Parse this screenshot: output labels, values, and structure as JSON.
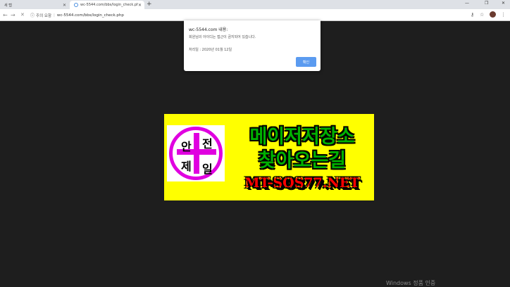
{
  "browser": {
    "tabs": [
      {
        "title": "새 탭",
        "active": false
      },
      {
        "title": "wc-5544.com/bbs/login_check.php",
        "active": true
      }
    ],
    "new_tab": "+",
    "window_controls": {
      "minimize": "—",
      "maximize": "❐",
      "close": "✕"
    },
    "nav": {
      "back": "←",
      "forward": "→",
      "reload": "✕"
    },
    "omnibox": {
      "security_label": "주의 요함",
      "url": "wc-5544.com/bbs/login_check.php"
    },
    "toolbar_icons": {
      "key": "key-icon",
      "star": "star-icon",
      "menu": "menu-icon"
    }
  },
  "alert": {
    "title": "wc-5544.com 내용:",
    "message": "회원님의 아이디는 접근이 금지되어 있습니다.",
    "date_line": "처리일 : 2020년 01월 12일",
    "ok_label": "확인"
  },
  "banner": {
    "logo_chars": [
      "안",
      "전",
      "제",
      "일"
    ],
    "line1": "메이저저장소",
    "line2": "찾아오는길",
    "line3": "MT-SOS77.NET",
    "colors": {
      "background": "#ffff00",
      "cross": "#e000e0",
      "headline": "#00b000",
      "url": "#ff0000"
    }
  },
  "watermark": "Windows 정품 인증"
}
